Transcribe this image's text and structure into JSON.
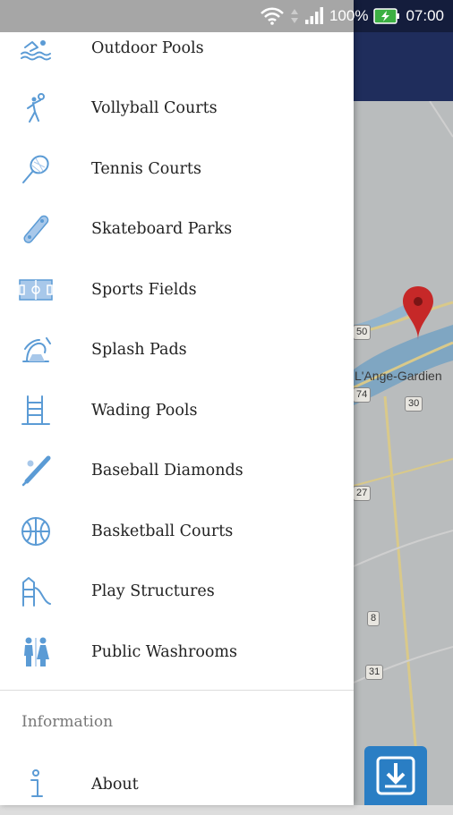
{
  "status_bar": {
    "battery": "100%",
    "time": "07:00"
  },
  "menu": {
    "items": [
      {
        "label": "Outdoor Pools",
        "icon": "swimmer-icon"
      },
      {
        "label": "Vollyball Courts",
        "icon": "volleyball-player-icon"
      },
      {
        "label": "Tennis Courts",
        "icon": "tennis-racket-icon"
      },
      {
        "label": "Skateboard Parks",
        "icon": "skateboard-icon"
      },
      {
        "label": "Sports Fields",
        "icon": "sports-field-icon"
      },
      {
        "label": "Splash Pads",
        "icon": "splash-pad-icon"
      },
      {
        "label": "Wading Pools",
        "icon": "pool-ladder-icon"
      },
      {
        "label": "Baseball Diamonds",
        "icon": "baseball-bat-icon"
      },
      {
        "label": "Basketball Courts",
        "icon": "basketball-icon"
      },
      {
        "label": "Play Structures",
        "icon": "playground-slide-icon"
      },
      {
        "label": "Public Washrooms",
        "icon": "washroom-icon"
      }
    ],
    "information_header": "Information",
    "about": {
      "label": "About",
      "icon": "info-icon"
    }
  },
  "map": {
    "place_label": "L'Ange-Gardien",
    "route_labels": [
      "50",
      "74",
      "30",
      "27",
      "8",
      "31"
    ]
  },
  "colors": {
    "icon_accent": "#5b9bd5",
    "app_bar": "#1f2d5c",
    "fab": "#2a7ec4",
    "marker": "#c62828"
  }
}
